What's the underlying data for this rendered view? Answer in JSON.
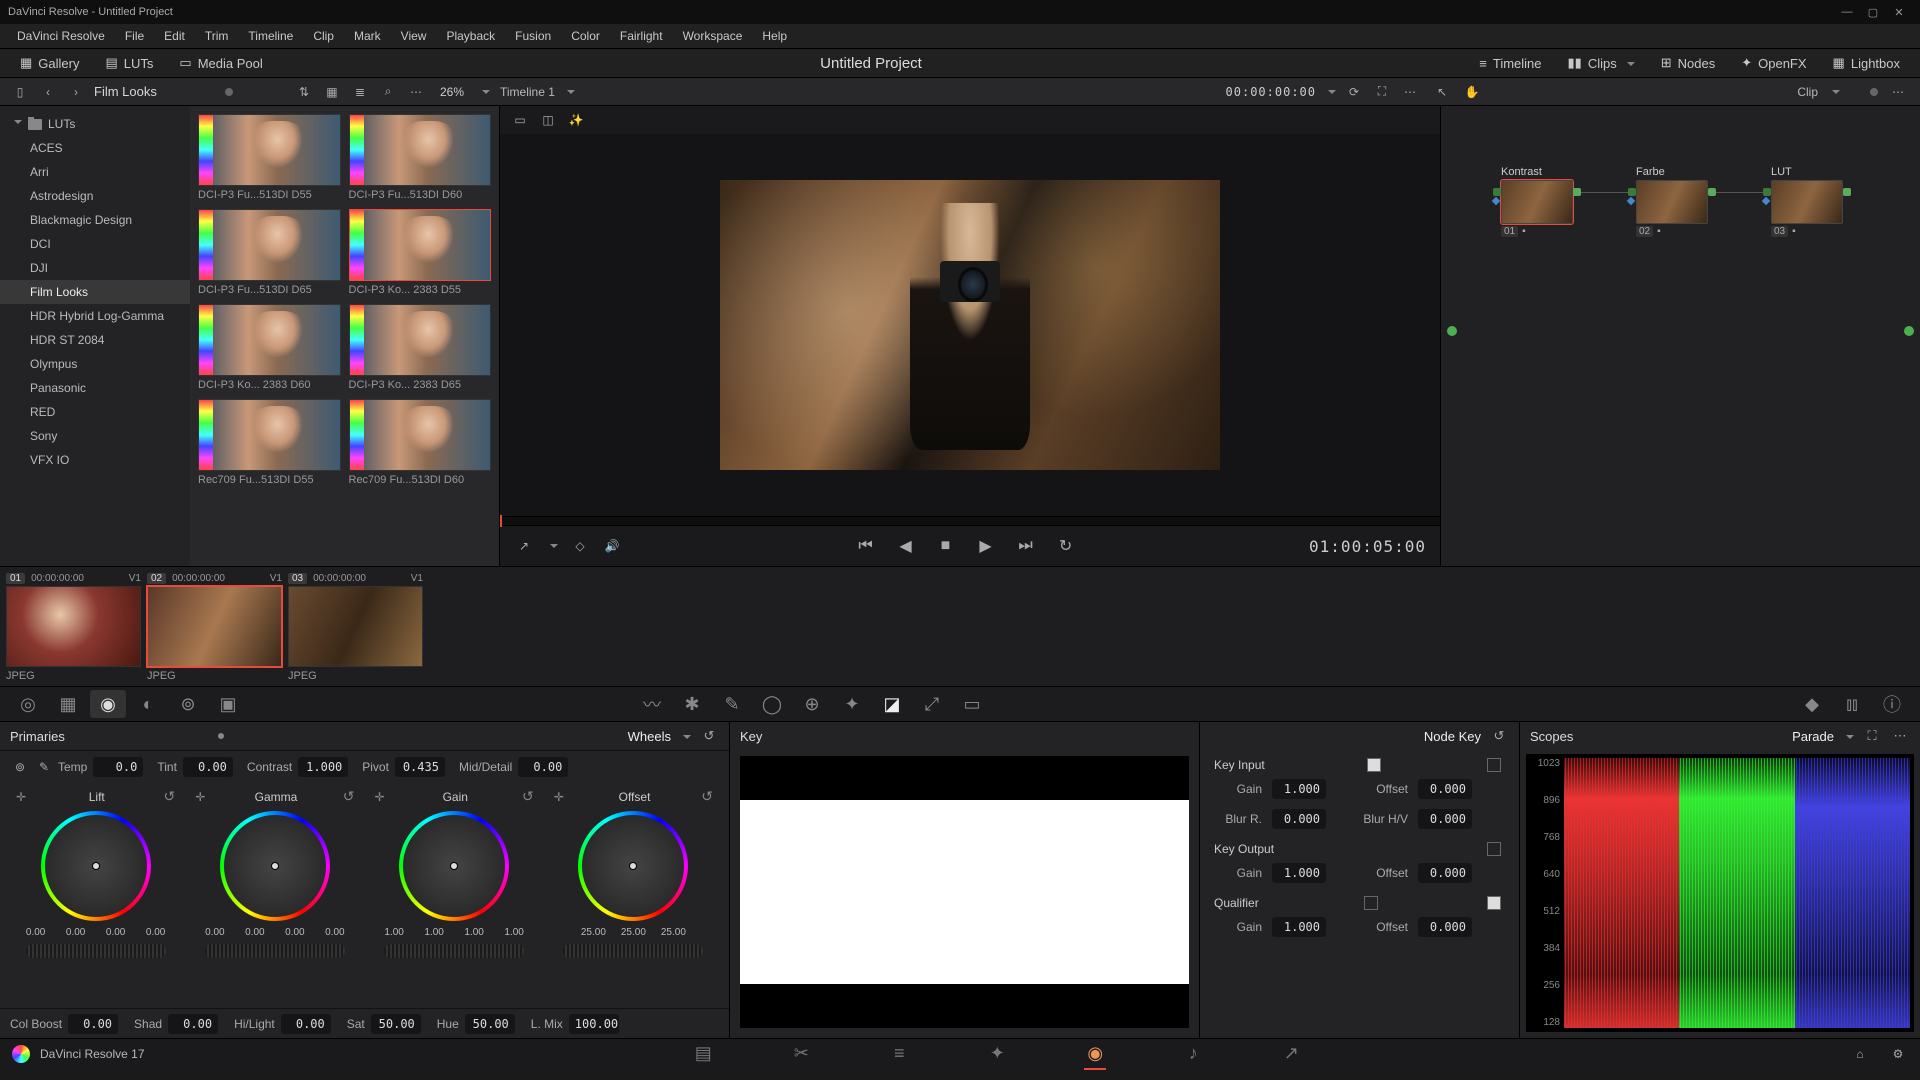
{
  "titlebar": {
    "title": "DaVinci Resolve - Untitled Project"
  },
  "menubar": [
    "DaVinci Resolve",
    "File",
    "Edit",
    "Trim",
    "Timeline",
    "Clip",
    "Mark",
    "View",
    "Playback",
    "Fusion",
    "Color",
    "Fairlight",
    "Workspace",
    "Help"
  ],
  "top_toolbar": {
    "gallery": "Gallery",
    "luts": "LUTs",
    "media_pool": "Media Pool",
    "project_title": "Untitled Project",
    "timeline": "Timeline",
    "clips": "Clips",
    "nodes": "Nodes",
    "openfx": "OpenFX",
    "lightbox": "Lightbox"
  },
  "sub_toolbar": {
    "section_title": "Film Looks",
    "zoom": "26%",
    "timeline_name": "Timeline 1",
    "timecode": "00:00:00:00",
    "clip_mode": "Clip"
  },
  "lut_tree": {
    "root": "LUTs",
    "items": [
      "ACES",
      "Arri",
      "Astrodesign",
      "Blackmagic Design",
      "DCI",
      "DJI",
      "Film Looks",
      "HDR Hybrid Log-Gamma",
      "HDR ST 2084",
      "Olympus",
      "Panasonic",
      "RED",
      "Sony",
      "VFX IO"
    ],
    "active_index": 6
  },
  "lut_thumbs": [
    {
      "label": "DCI-P3 Fu...513DI D55"
    },
    {
      "label": "DCI-P3 Fu...513DI D60"
    },
    {
      "label": "DCI-P3 Fu...513DI D65"
    },
    {
      "label": "DCI-P3 Ko... 2383 D55",
      "selected": true
    },
    {
      "label": "DCI-P3 Ko... 2383 D60"
    },
    {
      "label": "DCI-P3 Ko... 2383 D65"
    },
    {
      "label": "Rec709 Fu...513DI D55"
    },
    {
      "label": "Rec709 Fu...513DI D60"
    }
  ],
  "transport": {
    "timecode": "01:00:05:00"
  },
  "nodes": [
    {
      "label": "Kontrast",
      "nr": "01",
      "selected": true
    },
    {
      "label": "Farbe",
      "nr": "02"
    },
    {
      "label": "LUT",
      "nr": "03"
    }
  ],
  "clips": [
    {
      "nr": "01",
      "tc": "00:00:00:00",
      "track": "V1",
      "format": "JPEG"
    },
    {
      "nr": "02",
      "tc": "00:00:00:00",
      "track": "V1",
      "format": "JPEG",
      "selected": true
    },
    {
      "nr": "03",
      "tc": "00:00:00:00",
      "track": "V1",
      "format": "JPEG"
    }
  ],
  "primaries": {
    "title": "Primaries",
    "mode": "Wheels",
    "top_adjust": [
      {
        "label": "Temp",
        "value": "0.0"
      },
      {
        "label": "Tint",
        "value": "0.00"
      },
      {
        "label": "Contrast",
        "value": "1.000"
      },
      {
        "label": "Pivot",
        "value": "0.435"
      },
      {
        "label": "Mid/Detail",
        "value": "0.00"
      }
    ],
    "wheels": [
      {
        "name": "Lift",
        "vals": [
          "0.00",
          "0.00",
          "0.00",
          "0.00"
        ]
      },
      {
        "name": "Gamma",
        "vals": [
          "0.00",
          "0.00",
          "0.00",
          "0.00"
        ]
      },
      {
        "name": "Gain",
        "vals": [
          "1.00",
          "1.00",
          "1.00",
          "1.00"
        ]
      },
      {
        "name": "Offset",
        "vals": [
          "25.00",
          "25.00",
          "25.00"
        ]
      }
    ],
    "bottom_adjust": [
      {
        "label": "Col Boost",
        "value": "0.00"
      },
      {
        "label": "Shad",
        "value": "0.00"
      },
      {
        "label": "Hi/Light",
        "value": "0.00"
      },
      {
        "label": "Sat",
        "value": "50.00"
      },
      {
        "label": "Hue",
        "value": "50.00"
      },
      {
        "label": "L. Mix",
        "value": "100.00"
      }
    ]
  },
  "key_panel": {
    "title": "Key"
  },
  "node_key": {
    "title": "Node Key",
    "sections": {
      "input": {
        "title": "Key Input",
        "rows": [
          {
            "l": "Gain",
            "v": "1.000",
            "l2": "Offset",
            "v2": "0.000"
          },
          {
            "l": "Blur R.",
            "v": "0.000",
            "l2": "Blur H/V",
            "v2": "0.000"
          }
        ]
      },
      "output": {
        "title": "Key Output",
        "rows": [
          {
            "l": "Gain",
            "v": "1.000",
            "l2": "Offset",
            "v2": "0.000"
          }
        ]
      },
      "qualifier": {
        "title": "Qualifier",
        "rows": [
          {
            "l": "Gain",
            "v": "1.000",
            "l2": "Offset",
            "v2": "0.000"
          }
        ]
      }
    }
  },
  "scopes": {
    "title": "Scopes",
    "mode": "Parade",
    "scale": [
      "1023",
      "896",
      "768",
      "640",
      "512",
      "384",
      "256",
      "128"
    ]
  },
  "status": {
    "app": "DaVinci Resolve 17"
  }
}
